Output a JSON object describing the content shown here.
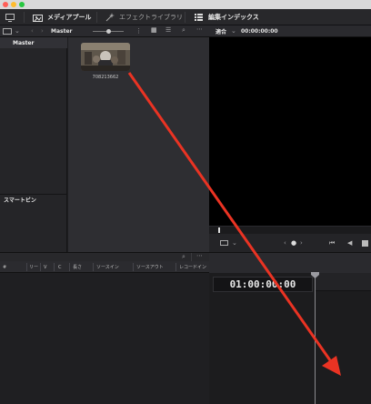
{
  "window": {
    "traffic_lights": [
      "#ff5f57",
      "#febc2e",
      "#28c840"
    ]
  },
  "toolbar": {
    "media_pool_label": "メディアプール",
    "effects_library_label": "エフェクトライブラリ",
    "edit_index_label": "編集インデックス",
    "icons": [
      "monitor-icon",
      "media-pool-icon",
      "effects-wand-icon",
      "list-icon"
    ]
  },
  "media_bar": {
    "bin_name": "Master",
    "viewer_fit": "適合",
    "viewer_timecode": "00:00:00:00"
  },
  "bins": {
    "master_label": "Master",
    "smart_bins_label": "スマートビン"
  },
  "media": {
    "clips": [
      {
        "name": "708213662"
      }
    ]
  },
  "list_columns": [
    "#",
    "リー",
    "V",
    "C",
    "長さ",
    "ソースイン",
    "ソースアウト",
    "レコードイン"
  ],
  "timeline": {
    "timecode": "01:00:00:00"
  },
  "annotation": {
    "arrow_color": "#ea3323"
  }
}
